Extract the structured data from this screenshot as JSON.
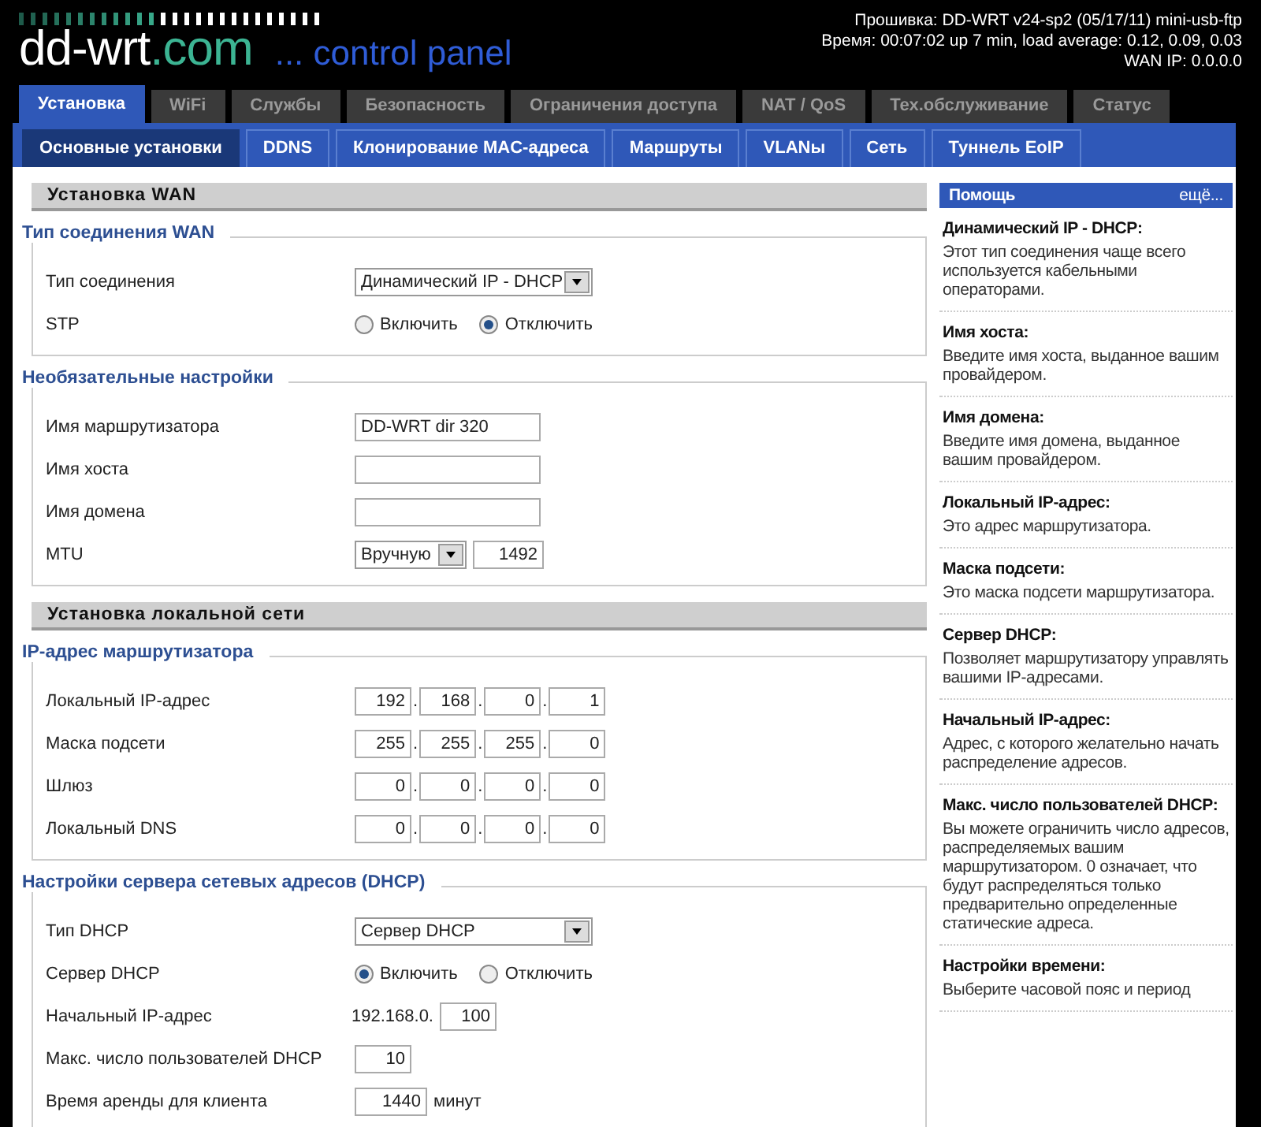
{
  "header": {
    "logo_main": "dd-wrt",
    "logo_suffix": ".com",
    "tagline": "... control panel",
    "info": [
      "Прошивка: DD-WRT v24-sp2 (05/17/11) mini-usb-ftp",
      "Время: 00:07:02 up 7 min, load average: 0.12, 0.09, 0.03",
      "WAN IP: 0.0.0.0"
    ]
  },
  "tabs": [
    {
      "label": "Установка",
      "selected": true
    },
    {
      "label": "WiFi",
      "selected": false
    },
    {
      "label": "Службы",
      "selected": false
    },
    {
      "label": "Безопасность",
      "selected": false
    },
    {
      "label": "Ограничения доступа",
      "selected": false
    },
    {
      "label": "NAT / QoS",
      "selected": false
    },
    {
      "label": "Тех.обслуживание",
      "selected": false
    },
    {
      "label": "Статус",
      "selected": false
    }
  ],
  "subtabs": [
    {
      "label": "Основные установки",
      "selected": true
    },
    {
      "label": "DDNS",
      "selected": false
    },
    {
      "label": "Клонирование MAC-адреса",
      "selected": false
    },
    {
      "label": "Маршруты",
      "selected": false
    },
    {
      "label": "VLANы",
      "selected": false
    },
    {
      "label": "Сеть",
      "selected": false
    },
    {
      "label": "Туннель EoIP",
      "selected": false
    }
  ],
  "sections": [
    {
      "title": "Установка WAN",
      "groups": [
        {
          "legend": "Тип соединения WAN",
          "rows": [
            {
              "label": "Тип соединения",
              "kind": "select",
              "value": "Динамический IP - DHCP"
            },
            {
              "label": "STP",
              "kind": "radio",
              "options": [
                {
                  "label": "Включить",
                  "selected": false
                },
                {
                  "label": "Отключить",
                  "selected": true
                }
              ]
            }
          ]
        },
        {
          "legend": "Необязательные настройки",
          "rows": [
            {
              "label": "Имя маршрутизатора",
              "kind": "text",
              "value": "DD-WRT dir 320"
            },
            {
              "label": "Имя хоста",
              "kind": "text"
            },
            {
              "label": "Имя домена",
              "kind": "text"
            },
            {
              "label": "MTU",
              "kind": "select_number",
              "select": "Вручную",
              "value": "1492"
            }
          ]
        }
      ]
    },
    {
      "title": "Установка локальной сети",
      "groups": [
        {
          "legend": "IP-адрес маршрутизатора",
          "rows": [
            {
              "label": "Локальный IP-адрес",
              "kind": "ip",
              "octets": [
                "192",
                "168",
                "0",
                "1"
              ],
              "separators": [
                ".",
                ".",
                "."
              ]
            },
            {
              "label": "Маска подсети",
              "kind": "ip",
              "octets": [
                "255",
                "255",
                "255",
                "0"
              ],
              "separators": [
                ".",
                ".",
                "."
              ]
            },
            {
              "label": "Шлюз",
              "kind": "ip",
              "octets": [
                "0",
                "0",
                "0",
                "0"
              ],
              "separators": [
                ".",
                ".",
                "."
              ]
            },
            {
              "label": "Локальный DNS",
              "kind": "ip",
              "octets": [
                "0",
                "0",
                "0",
                "0"
              ],
              "separators": [
                ".",
                ".",
                "."
              ]
            }
          ]
        },
        {
          "legend": "Настройки сервера сетевых адресов (DHCP)",
          "rows": [
            {
              "label": "Тип DHCP",
              "kind": "select",
              "value": "Сервер DHCP"
            },
            {
              "label": "Сервер DHCP",
              "kind": "radio",
              "options": [
                {
                  "label": "Включить",
                  "selected": true
                },
                {
                  "label": "Отключить",
                  "selected": false
                }
              ]
            },
            {
              "label": "Начальный IP-адрес",
              "kind": "prefix_number",
              "prefix": "192.168.0.",
              "value": "100"
            },
            {
              "label": "Макс. число пользователей DHCP",
              "kind": "number",
              "value": "10"
            },
            {
              "label": "Время аренды для клиента",
              "kind": "number_unit",
              "value": "1440",
              "unit": "минут"
            }
          ]
        }
      ]
    }
  ],
  "help": {
    "title": "Помощь",
    "more": "ещё...",
    "items": [
      {
        "term": "Динамический IP - DHCP:",
        "text": "Этот тип соединения чаще всего используется кабельными операторами."
      },
      {
        "term": "Имя хоста:",
        "text": "Введите имя хоста, выданное вашим провайдером."
      },
      {
        "term": "Имя домена:",
        "text": "Введите имя домена, выданное вашим провайдером."
      },
      {
        "term": "Локальный IP-адрес:",
        "text": "Это адрес маршрутизатора."
      },
      {
        "term": "Маска подсети:",
        "text": "Это маска подсети маршрутизатора."
      },
      {
        "term": "Сервер DHCP:",
        "text": "Позволяет маршрутизатору управлять вашими IP-адресами."
      },
      {
        "term": "Начальный IP-адрес:",
        "text": "Адрес, с которого желательно начать распределение адресов."
      },
      {
        "term": "Макс. число пользователей DHCP:",
        "text": "Вы можете ограничить число адресов, распределяемых вашим маршрутизатором. 0 означает, что будут распределяться только предварительно определенные статические адреса."
      },
      {
        "term": "Настройки времени:",
        "text": "Выберите часовой пояс и период"
      }
    ]
  }
}
